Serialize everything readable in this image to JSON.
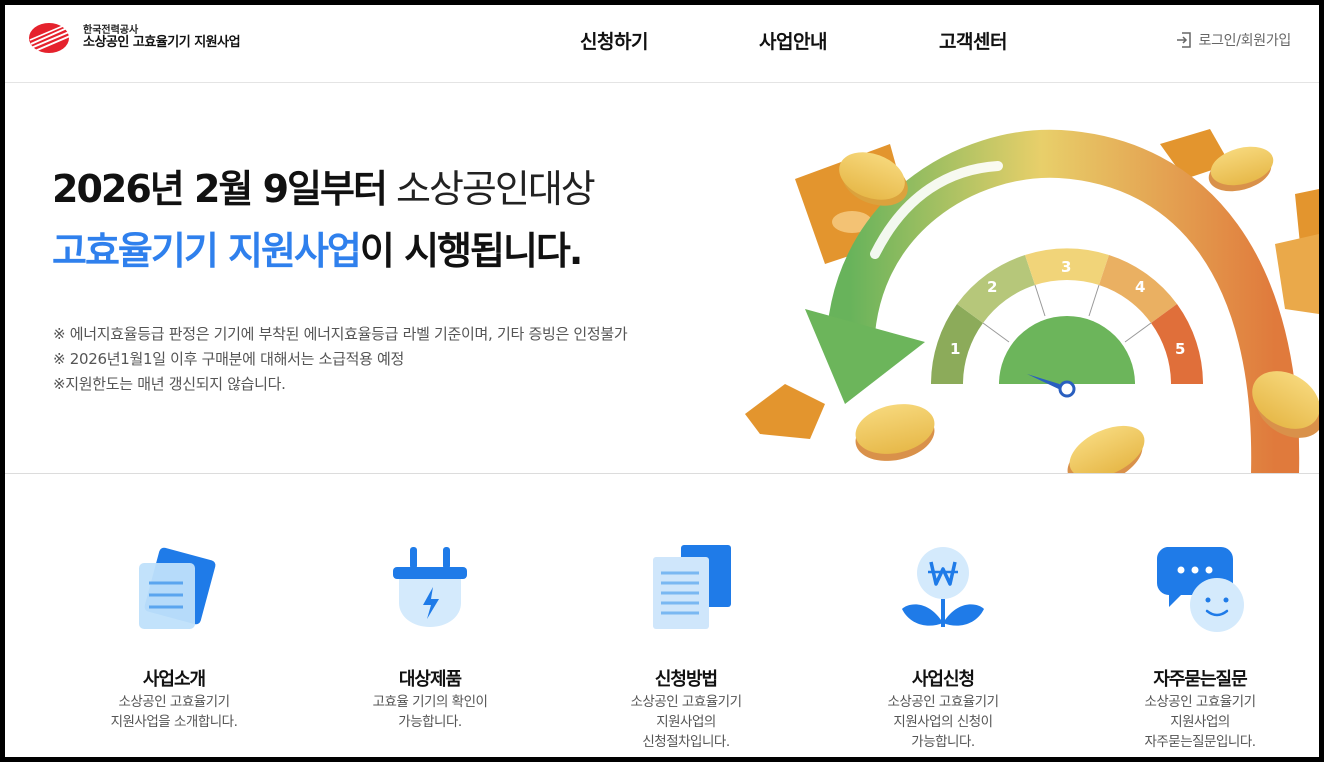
{
  "header": {
    "org": "한국전력공사",
    "title": "소상공인 고효율기기 지원사업",
    "nav": [
      "신청하기",
      "사업안내",
      "고객센터"
    ],
    "login": "로그인/회원가입"
  },
  "hero": {
    "line1_bold": "2026년 2월 9일부터",
    "line1_light": " 소상공인대상",
    "line2_blue": "고효율기기 지원사업",
    "line2_rest": "이 시행됩니다.",
    "notes": [
      "※ 에너지효율등급 판정은 기기에 부착된 에너지효율등급 라벨 기준이며, 기타 증빙은 인정불가",
      "※ 2026년1월1일 이후 구매분에 대해서는 소급적용 예정",
      "※지원한도는 매년 갱신되지 않습니다."
    ],
    "gauge_labels": [
      "1",
      "2",
      "3",
      "4",
      "5"
    ]
  },
  "services": [
    {
      "title": "사업소개",
      "desc": [
        "소상공인 고효율기기",
        "지원사업을 소개합니다."
      ],
      "icon": "document-icon"
    },
    {
      "title": "대상제품",
      "desc": [
        "고효율 기기의 확인이",
        "가능합니다."
      ],
      "icon": "plug-icon"
    },
    {
      "title": "신청방법",
      "desc": [
        "소상공인 고효율기기",
        "지원사업의",
        "신청절차입니다."
      ],
      "icon": "files-icon"
    },
    {
      "title": "사업신청",
      "desc": [
        "소상공인 고효율기기",
        "지원사업의 신청이",
        "가능합니다."
      ],
      "icon": "won-plant-icon"
    },
    {
      "title": "자주묻는질문",
      "desc": [
        "소상공인 고효율기기",
        "지원사업의",
        "자주묻는질문입니다."
      ],
      "icon": "chat-icon"
    }
  ],
  "colors": {
    "accent": "#2f80ed",
    "brand_red": "#e5222d",
    "gauge_green": "#6cb55b",
    "gauge_orange": "#e06f3a"
  }
}
